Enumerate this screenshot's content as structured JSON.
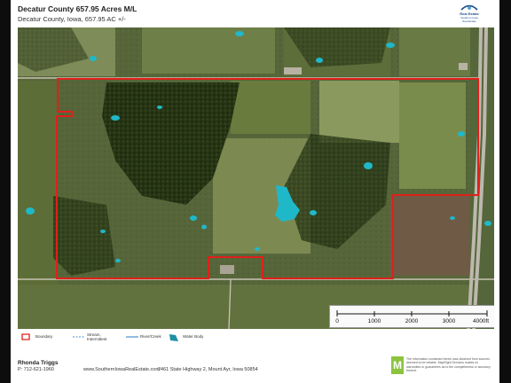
{
  "header": {
    "title": "Decatur County 657.95 Acres M/L",
    "subtitle": "Decatur County, Iowa, 657.95 AC +/-"
  },
  "logo": {
    "line1": "Real Estate",
    "line2": "Southern Iowa",
    "line3": "Real Estate",
    "color": "#1d4e89"
  },
  "map": {
    "boundary_color": "#e0201b",
    "water_color": "#1fb8c9",
    "scale": {
      "ticks": [
        "0",
        "1000",
        "2000",
        "3000",
        "4000ft"
      ],
      "tick_values_ft": [
        0,
        1000,
        2000,
        3000,
        4000
      ]
    }
  },
  "legend": {
    "items": [
      {
        "label": "Boundary",
        "icon": "boundary-icon"
      },
      {
        "label": "Stream, Intermittent",
        "icon": "stream-icon"
      },
      {
        "label": "River/Creek",
        "icon": "river-icon"
      },
      {
        "label": "Water Body",
        "icon": "water-body-icon"
      }
    ]
  },
  "footer": {
    "agent_name": "Rhonda Triggs",
    "agent_phone": "P: 712-621-1960",
    "website": "www.SouthernIowaRealEstate.com",
    "address": "2461 State Highway 2, Mount Ayr, Iowa 50854",
    "badge": "M",
    "disclaimer": "The information contained herein was obtained from sources deemed to be reliable. MapRight Services makes no warranties or guarantees as to the completeness or accuracy thereof."
  }
}
